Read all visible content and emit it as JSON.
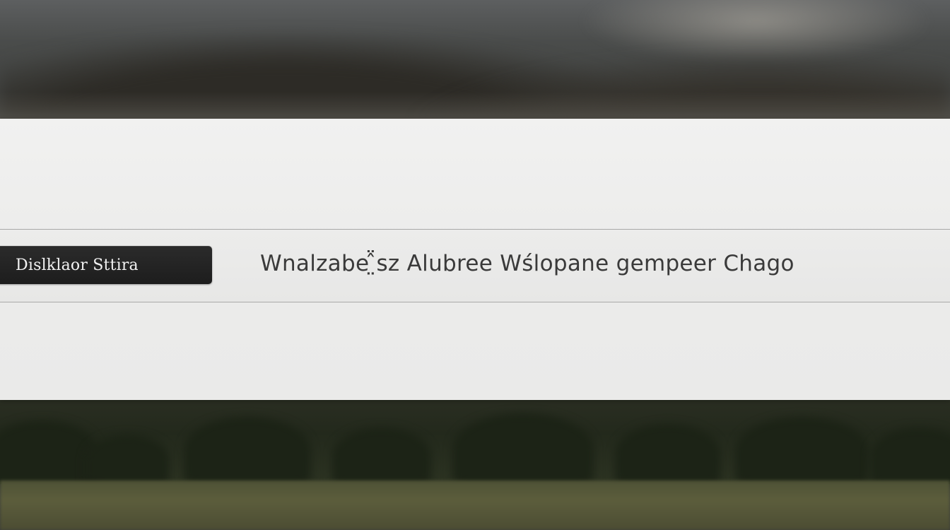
{
  "bar": {
    "button_label": "Dislklaor Sttira",
    "message": "Wnalzabe ̤̂̈sz Alubree Wślopane gempeer Chago"
  },
  "colors": {
    "panel": "#ececeb",
    "button": "#1d1d1d",
    "button_text": "#f2f2f2",
    "message_text": "#3a3a3a",
    "divider": "#a9a9a8"
  },
  "icons": {
    "background": "blurred-landscape-photo"
  }
}
